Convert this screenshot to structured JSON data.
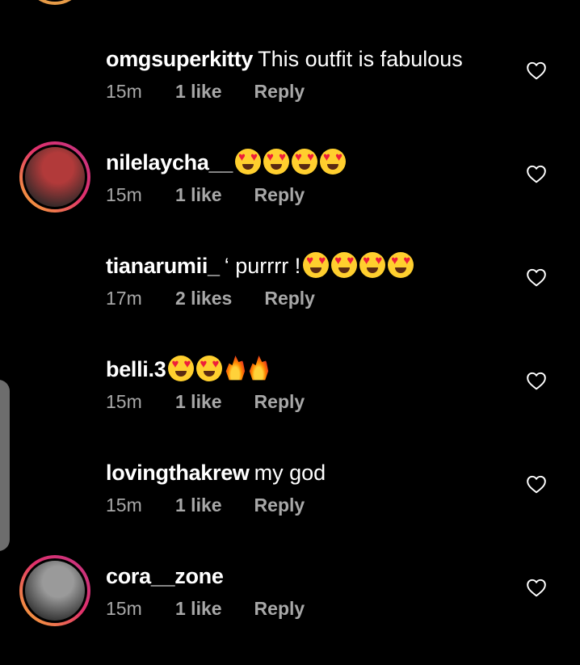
{
  "comments": [
    {
      "username": "omgsuperkitty",
      "text": "This outfit is fabulous",
      "emojis": [],
      "time": "15m",
      "likes": "1 like",
      "reply": "Reply",
      "story_ring": false,
      "avatar_colors": [
        "#2a2a2a",
        "#c9a3b6"
      ]
    },
    {
      "username": "nilelaycha__",
      "text": "",
      "emojis": [
        "heart-eyes",
        "heart-eyes",
        "heart-eyes",
        "heart-eyes"
      ],
      "time": "15m",
      "likes": "1 like",
      "reply": "Reply",
      "story_ring": true,
      "avatar_colors": [
        "#3a2a2a",
        "#b23a3a"
      ]
    },
    {
      "username": "tianarumii_",
      "text": "‘ purrrr !",
      "emojis": [
        "heart-eyes",
        "heart-eyes",
        "heart-eyes",
        "heart-eyes"
      ],
      "time": "17m",
      "likes": "2 likes",
      "reply": "Reply",
      "story_ring": false,
      "avatar_colors": [
        "#4a3a5a",
        "#8a6a9a"
      ]
    },
    {
      "username": "belli.3",
      "text": "",
      "emojis": [
        "heart-eyes",
        "heart-eyes",
        "fire",
        "fire"
      ],
      "time": "15m",
      "likes": "1 like",
      "reply": "Reply",
      "story_ring": false,
      "avatar_colors": [
        "#3a3a3a",
        "#6a5a5a"
      ]
    },
    {
      "username": "lovingthakrew",
      "text": "my god",
      "emojis": [],
      "time": "15m",
      "likes": "1 like",
      "reply": "Reply",
      "story_ring": false,
      "avatar_colors": [
        "#2a2020",
        "#7a4a3a"
      ]
    },
    {
      "username": "cora__zone",
      "text": "",
      "emojis": [],
      "time": "15m",
      "likes": "1 like",
      "reply": "Reply",
      "story_ring": true,
      "avatar_colors": [
        "#3a3a3a",
        "#9a9a9a"
      ]
    }
  ],
  "icons": {
    "like": "heart-outline-icon"
  }
}
